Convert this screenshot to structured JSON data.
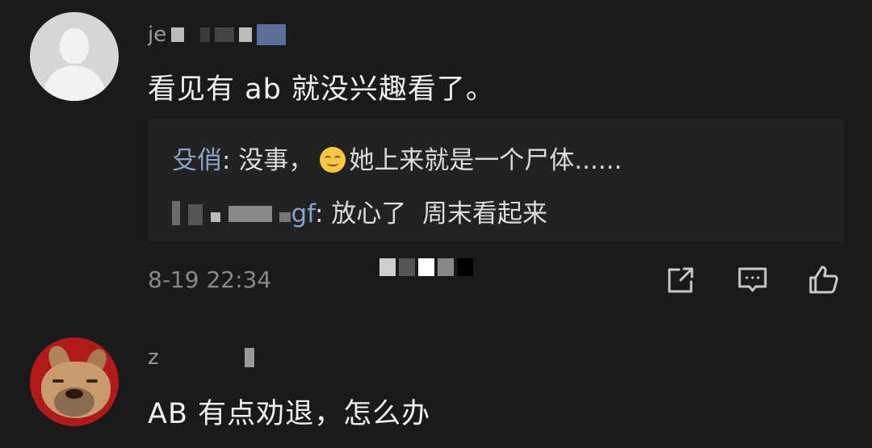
{
  "comments": [
    {
      "username_visible": "je",
      "text": "看见有 ab 就没兴趣看了。",
      "replies": [
        {
          "name": "殳俏",
          "separator": ": ",
          "text_before_emoji": "没事，",
          "emoji": "smile-emoji",
          "text_after_emoji": "她上来就是一个尸体......"
        },
        {
          "name_suffix": "gf",
          "separator": ": ",
          "text": "放心了  周末看起来"
        }
      ],
      "timestamp": "8-19 22:34",
      "actions": [
        "share-icon",
        "comment-icon",
        "like-icon"
      ]
    },
    {
      "username_visible": "z",
      "text": "AB 有点劝退，怎么办"
    }
  ],
  "colors": {
    "background": "#1a1a1a",
    "reply_name": "#8aa2c8",
    "text": "#f0f0f0",
    "muted": "#8a8a8a"
  }
}
